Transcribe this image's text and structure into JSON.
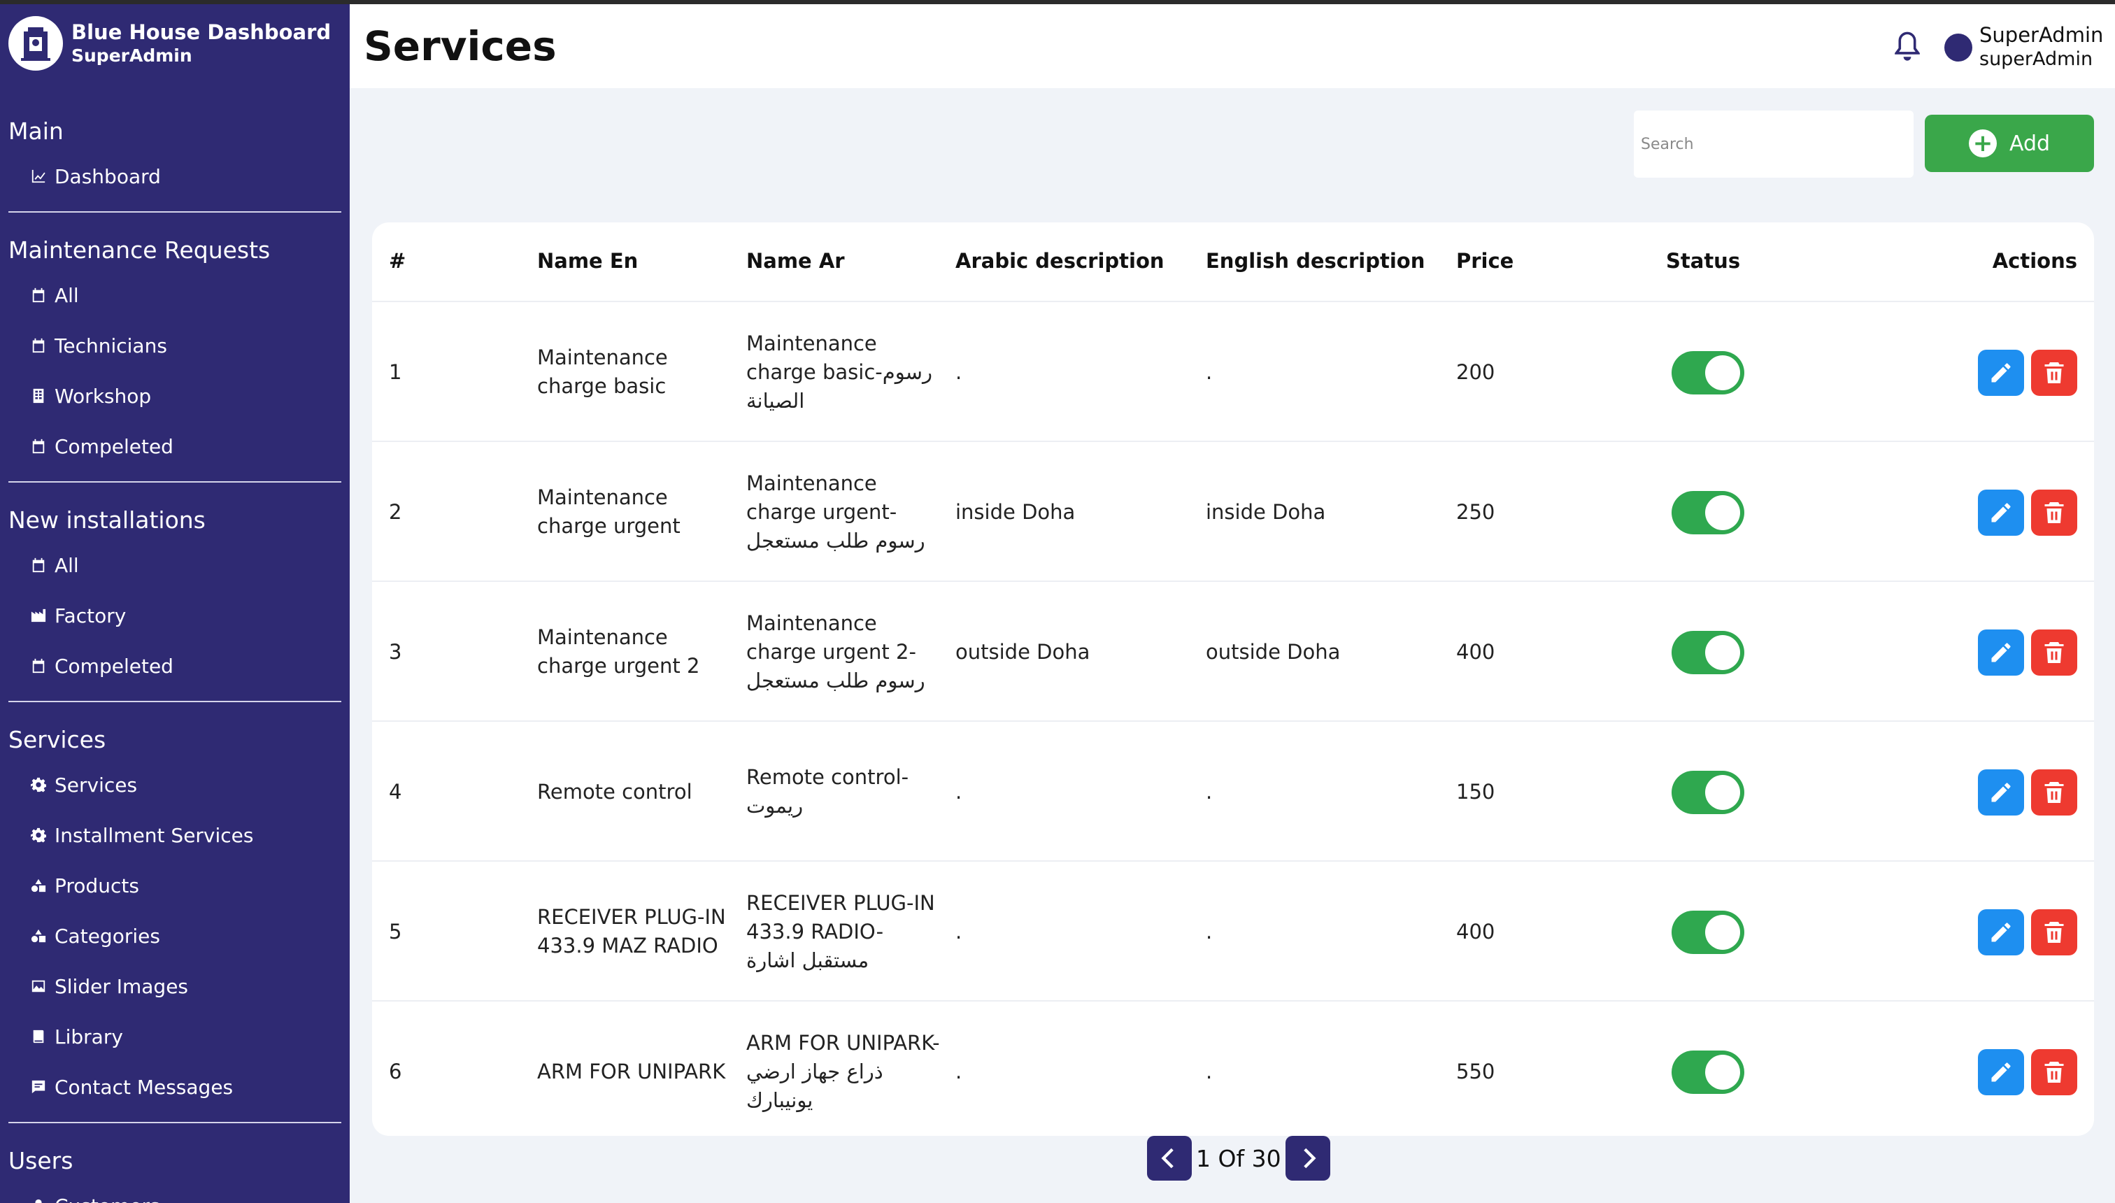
{
  "sidebar": {
    "brand_title": "Blue House Dashboard",
    "brand_sub": "SuperAdmin",
    "sections": [
      {
        "title": "Main",
        "items": [
          {
            "label": "Dashboard",
            "icon": "chart-icon"
          }
        ]
      },
      {
        "title": "Maintenance Requests",
        "items": [
          {
            "label": "All",
            "icon": "calendar-icon"
          },
          {
            "label": "Technicians",
            "icon": "calendar-icon"
          },
          {
            "label": "Workshop",
            "icon": "building-icon"
          },
          {
            "label": "Compeleted",
            "icon": "calendar-icon"
          }
        ]
      },
      {
        "title": "New installations",
        "items": [
          {
            "label": "All",
            "icon": "calendar-icon"
          },
          {
            "label": "Factory",
            "icon": "factory-icon"
          },
          {
            "label": "Compeleted",
            "icon": "calendar-icon"
          }
        ]
      },
      {
        "title": "Services",
        "items": [
          {
            "label": "Services",
            "icon": "gear-icon"
          },
          {
            "label": "Installment Services",
            "icon": "gear-icon"
          },
          {
            "label": "Products",
            "icon": "shapes-icon"
          },
          {
            "label": "Categories",
            "icon": "shapes-icon"
          },
          {
            "label": "Slider Images",
            "icon": "image-icon"
          },
          {
            "label": "Library",
            "icon": "book-icon"
          },
          {
            "label": "Contact Messages",
            "icon": "message-icon"
          }
        ]
      },
      {
        "title": "Users",
        "items": [
          {
            "label": "Customers",
            "icon": "user-icon"
          }
        ]
      }
    ]
  },
  "header": {
    "title": "Services",
    "user_name": "SuperAdmin",
    "user_role": "superAdmin"
  },
  "toolbar": {
    "search_placeholder": "Search",
    "add_label": "Add"
  },
  "table": {
    "columns": [
      "#",
      "Name En",
      "Name Ar",
      "Arabic description",
      "English description",
      "Price",
      "Status",
      "Actions"
    ],
    "rows": [
      {
        "id": "1",
        "name_en": [
          "Maintenance",
          "charge basic"
        ],
        "name_ar": [
          "Maintenance",
          "charge basic-رسوم",
          "الصيانة"
        ],
        "desc_ar": ".",
        "desc_en": ".",
        "price": "200",
        "status": true
      },
      {
        "id": "2",
        "name_en": [
          "Maintenance",
          "charge urgent"
        ],
        "name_ar": [
          "Maintenance",
          "charge urgent-",
          "رسوم طلب مستعجل"
        ],
        "desc_ar": "inside Doha",
        "desc_en": "inside Doha",
        "price": "250",
        "status": true
      },
      {
        "id": "3",
        "name_en": [
          "Maintenance",
          "charge urgent 2"
        ],
        "name_ar": [
          "Maintenance",
          "charge urgent 2-",
          "رسوم طلب مستعجل"
        ],
        "desc_ar": "outside Doha",
        "desc_en": "outside Doha",
        "price": "400",
        "status": true
      },
      {
        "id": "4",
        "name_en": [
          "Remote control"
        ],
        "name_ar": [
          "Remote control-",
          "ريموت"
        ],
        "desc_ar": ".",
        "desc_en": ".",
        "price": "150",
        "status": true
      },
      {
        "id": "5",
        "name_en": [
          "RECEIVER  PLUG-IN",
          "433.9 MAZ RADIO"
        ],
        "name_ar": [
          "RECEIVER  PLUG-IN",
          "433.9  RADIO-",
          "مستقبل اشارة"
        ],
        "desc_ar": ".",
        "desc_en": ".",
        "price": "400",
        "status": true
      },
      {
        "id": "6",
        "name_en": [
          "ARM FOR UNIPARK"
        ],
        "name_ar": [
          "ARM FOR UNIPARK-",
          "ذراع جهاز ارضي",
          "يونيبارك"
        ],
        "desc_ar": ".",
        "desc_en": ".",
        "price": "550",
        "status": true
      }
    ]
  },
  "pagination": {
    "text": "1 Of 30"
  },
  "colors": {
    "sidebar": "#2f2a73",
    "add": "#3aa74a",
    "toggle": "#2fa84f",
    "edit": "#1e8ff0",
    "delete": "#ee3a30"
  }
}
